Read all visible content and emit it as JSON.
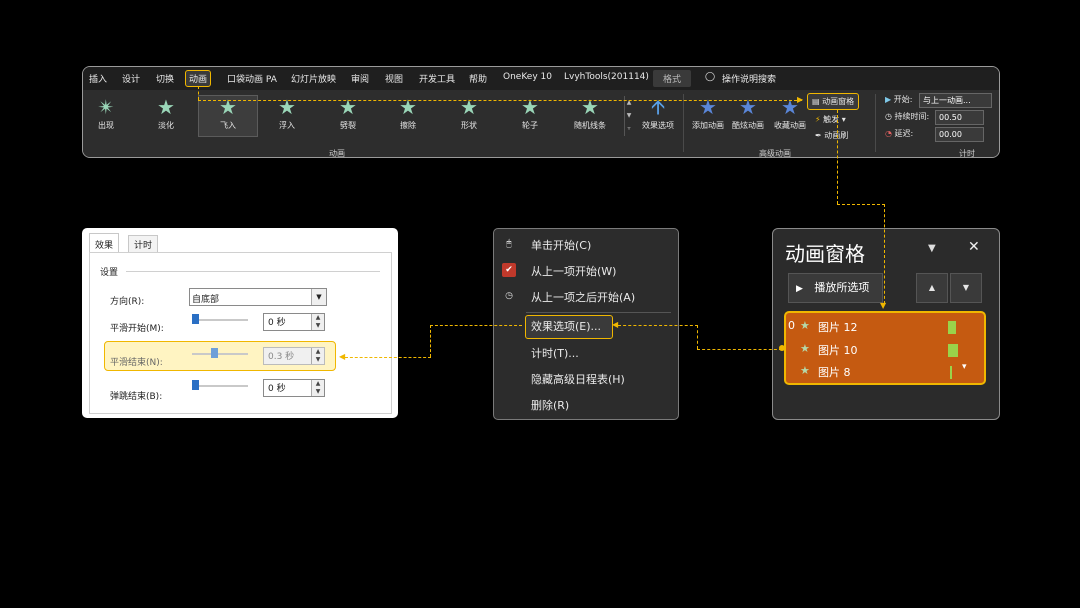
{
  "ribbon": {
    "tabs": [
      "插入",
      "设计",
      "切换",
      "动画",
      "口袋动画 PA",
      "幻灯片放映",
      "审阅",
      "视图",
      "开发工具",
      "帮助",
      "OneKey 10",
      "LvyhTools(201114)",
      "格式",
      "操作说明搜索"
    ],
    "effects": [
      "出现",
      "淡化",
      "飞入",
      "浮入",
      "劈裂",
      "擦除",
      "形状",
      "轮子",
      "随机线条"
    ],
    "effect_options": "效果选项",
    "group_animation": "动画",
    "adv": {
      "add": "添加动画",
      "painter": "酷炫动画",
      "collect": "收藏动画",
      "pane": "动画窗格",
      "trigger": "触发",
      "brush": "动画刷",
      "group": "高级动画"
    },
    "timing": {
      "start_label": "开始:",
      "start_value": "与上一动画...",
      "duration_label": "持续时间:",
      "duration_value": "00.50",
      "delay_label": "延迟:",
      "delay_value": "00.00",
      "group": "计时"
    }
  },
  "dialog": {
    "tabs": [
      "效果",
      "计时"
    ],
    "section": "设置",
    "direction_label": "方向(R):",
    "direction_value": "自底部",
    "smooth_start_label": "平滑开始(M):",
    "smooth_start_value": "0 秒",
    "smooth_end_label": "平滑结束(N):",
    "smooth_end_value": "0.3 秒",
    "bounce_end_label": "弹跳结束(B):",
    "bounce_end_value": "0 秒"
  },
  "menu": {
    "items": [
      "单击开始(C)",
      "从上一项开始(W)",
      "从上一项之后开始(A)",
      "效果选项(E)...",
      "计时(T)...",
      "隐藏高级日程表(H)",
      "删除(R)"
    ]
  },
  "pane": {
    "title": "动画窗格",
    "play": "播放所选项",
    "index": "0",
    "items": [
      "图片 12",
      "图片 10",
      "图片 8"
    ]
  },
  "colors": {
    "accent": "#f0b700",
    "selection": "#c55a11",
    "bar": "#9ad34a"
  }
}
